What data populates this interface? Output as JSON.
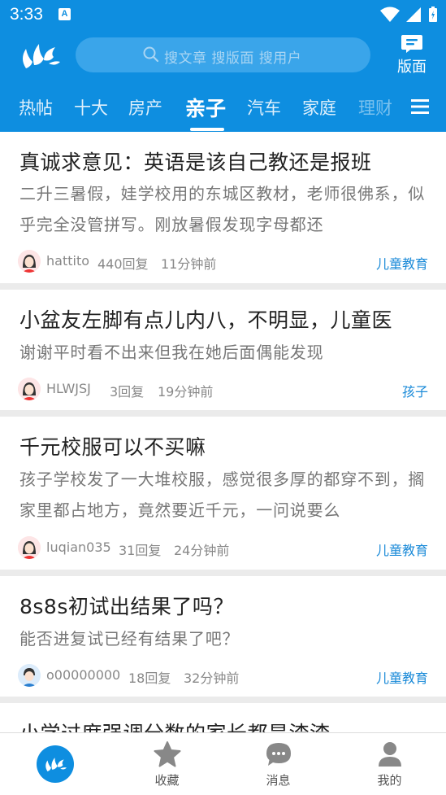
{
  "status_bar": {
    "time": "3:33",
    "notif_letter": "A"
  },
  "header": {
    "search_placeholder": "搜文章 搜版面 搜用户",
    "board_label": "版面"
  },
  "tabs": [
    "热帖",
    "十大",
    "房产",
    "亲子",
    "汽车",
    "家庭",
    "理财"
  ],
  "active_tab": "亲子",
  "posts": [
    {
      "title": "真诚求意见：英语是该自己教还是报班",
      "excerpt": "二升三暑假，娃学校用的东城区教材，老师很佛系，似乎完全没管拼写。刚放暑假发现字母都还",
      "author": "hattito",
      "replies": "440回复",
      "time": "11分钟前",
      "tag": "儿童教育"
    },
    {
      "title": "小盆友左脚有点儿内八，不明显，儿童医",
      "excerpt": "谢谢平时看不出来但我在她后面偶能发现",
      "author": "HLWJSJ",
      "replies": "3回复",
      "time": "19分钟前",
      "tag": "孩子"
    },
    {
      "title": "千元校服可以不买嘛",
      "excerpt": "孩子学校发了一大堆校服，感觉很多厚的都穿不到，搁家里都占地方，竟然要近千元，一问说要么",
      "author": "luqian035",
      "replies": "31回复",
      "time": "24分钟前",
      "tag": "儿童教育"
    },
    {
      "title": "8s8s初试出结果了吗？",
      "excerpt": "能否进复试已经有结果了吧？",
      "author": "o00000000",
      "replies": "18回复",
      "time": "32分钟前",
      "tag": "儿童教育"
    },
    {
      "title": "小学过度强调分数的家长都是渣渣"
    }
  ],
  "bottom_nav": {
    "favorites": "收藏",
    "messages": "消息",
    "mine": "我的"
  },
  "colors": {
    "brand": "#0e8ee0",
    "tag": "#1a8ad8"
  }
}
